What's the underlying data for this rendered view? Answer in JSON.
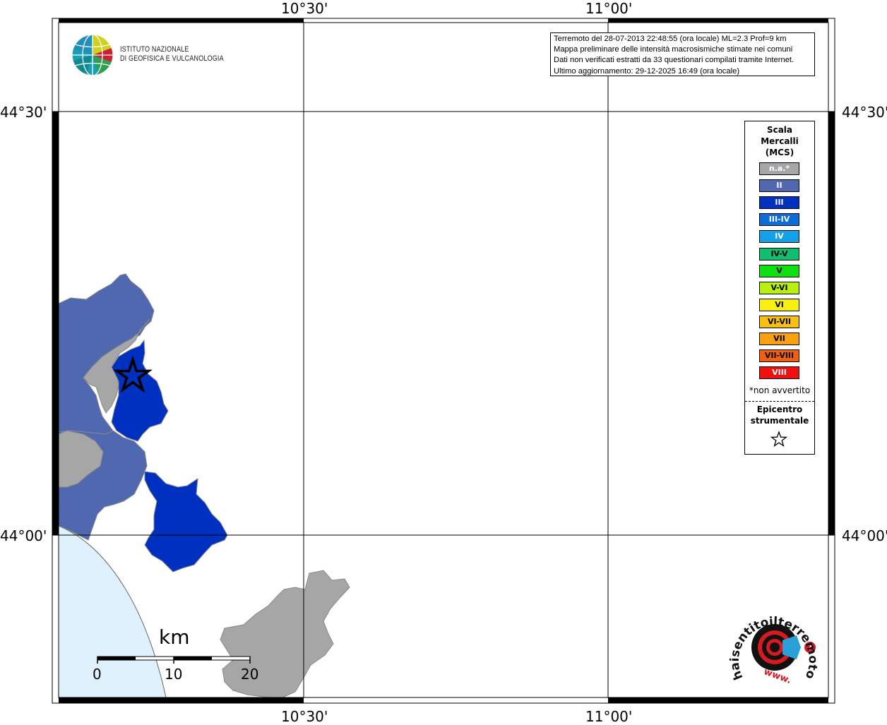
{
  "axes": {
    "top_ticks": [
      "10°30'",
      "11°00'"
    ],
    "bottom_ticks": [
      "10°30'",
      "11°00'"
    ],
    "left_ticks": [
      "44°30'",
      "44°00'"
    ],
    "right_ticks": [
      "44°30'",
      "44°00'"
    ]
  },
  "institute": {
    "line1": "ISTITUTO NAZIONALE",
    "line2": "DI GEOFISICA E VULCANOLOGIA"
  },
  "info": {
    "line1": "Terremoto del 28-07-2013 22:48:55 (ora locale) ML=2.3 Prof=9 km",
    "line2": "Mappa preliminare delle intensità macrosismiche stimate nei comuni",
    "line3": "Dati non verificati estratti da 33 questionari compilati tramite Internet.",
    "line4": "Ultimo aggiornamento: 29-12-2025 16:49 (ora locale)"
  },
  "legend": {
    "title_line1": "Scala",
    "title_line2": "Mercalli",
    "title_line3": "(MCS)",
    "classes": [
      {
        "label": "n.a.*",
        "color": "#a6a6a6",
        "text_color": "#ffffff"
      },
      {
        "label": "II",
        "color": "#5068b0",
        "text_color": "#ffffff"
      },
      {
        "label": "III",
        "color": "#0030c0",
        "text_color": "#ffffff"
      },
      {
        "label": "III-IV",
        "color": "#0a6cd8",
        "text_color": "#ffffff"
      },
      {
        "label": "IV",
        "color": "#12a0e8",
        "text_color": "#ffffff"
      },
      {
        "label": "IV-V",
        "color": "#10c070",
        "text_color": "#000000"
      },
      {
        "label": "V",
        "color": "#10e010",
        "text_color": "#000000"
      },
      {
        "label": "V-VI",
        "color": "#b8f010",
        "text_color": "#000000"
      },
      {
        "label": "VI",
        "color": "#f8f010",
        "text_color": "#000000"
      },
      {
        "label": "VI-VII",
        "color": "#f8c010",
        "text_color": "#000000"
      },
      {
        "label": "VII",
        "color": "#f8a010",
        "text_color": "#000000"
      },
      {
        "label": "VII-VIII",
        "color": "#f06010",
        "text_color": "#000000"
      },
      {
        "label": "VIII",
        "color": "#f01010",
        "text_color": "#ffffff"
      }
    ],
    "note": "*non avvertito",
    "epicenter_line1": "Epicentro",
    "epicenter_line2": "strumentale"
  },
  "scale_bar": {
    "unit": "km",
    "labels": [
      "0",
      "10",
      "20"
    ]
  },
  "colors": {
    "sea": "#dff1fd",
    "not_felt": "#a6a6a6",
    "intensity_II": "#5068b0",
    "intensity_III": "#0030c0"
  },
  "watermark": {
    "text": "haisentitoilterremoto.it",
    "url_text": "www."
  }
}
